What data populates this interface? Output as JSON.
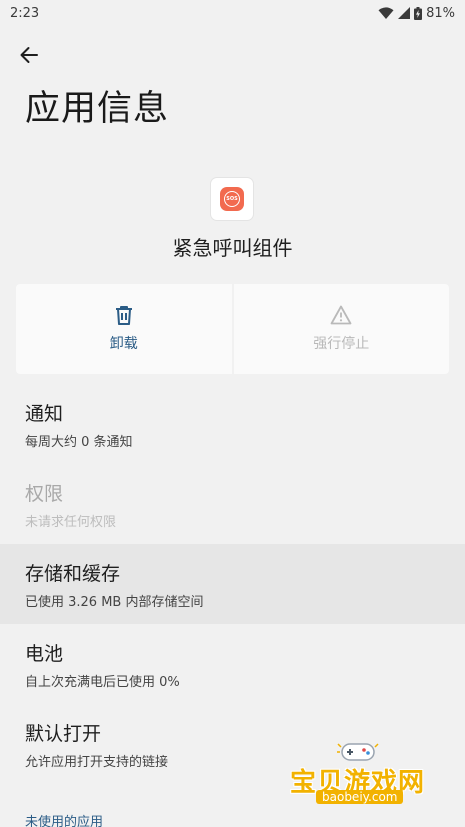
{
  "status_bar": {
    "time": "2:23",
    "battery": "81%",
    "icons": [
      "wifi-icon",
      "cellular-signal-icon",
      "battery-charging-icon"
    ]
  },
  "page": {
    "title": "应用信息"
  },
  "app": {
    "name": "紧急呼叫组件",
    "icon_text": "SOS",
    "icon_color": "#f26a4f"
  },
  "actions": {
    "uninstall": {
      "label": "卸载",
      "icon": "trash-icon",
      "enabled": true
    },
    "force_stop": {
      "label": "强行停止",
      "icon": "warning-triangle-icon",
      "enabled": false
    }
  },
  "items": [
    {
      "title": "通知",
      "subtitle": "每周大约 0 条通知",
      "enabled": true
    },
    {
      "title": "权限",
      "subtitle": "未请求任何权限",
      "enabled": false
    },
    {
      "title": "存储和缓存",
      "subtitle": "已使用 3.26 MB 内部存储空间",
      "enabled": true
    },
    {
      "title": "电池",
      "subtitle": "自上次充满电后已使用 0%",
      "enabled": true
    },
    {
      "title": "默认打开",
      "subtitle": "允许应用打开支持的链接",
      "enabled": true
    }
  ],
  "section": {
    "unused_apps": "未使用的应用"
  },
  "watermark": {
    "name": "宝贝游戏网",
    "url": "baobeiy.com"
  },
  "colors": {
    "accent": "#2b5c86",
    "background": "#f1f1f1",
    "disabled": "#b9b9b9"
  }
}
